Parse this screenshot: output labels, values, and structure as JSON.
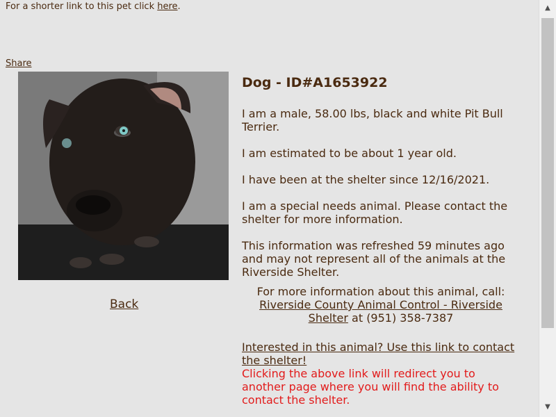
{
  "header": {
    "shortlink_text": "For a shorter link to this pet click ",
    "shortlink_link": "here",
    "shortlink_end": "."
  },
  "share_label": "Share",
  "pet": {
    "title": "Dog - ID#A1653922",
    "description": "I am a male, 58.00 lbs, black and white Pit Bull Terrier.",
    "age": "I am estimated to be about 1 year old.",
    "since": "I have been at the shelter since 12/16/2021.",
    "special_needs": "I am a special needs animal. Please contact the shelter for more information.",
    "refresh": "This information was refreshed 59 minutes ago and may not represent all of the animals at the Riverside Shelter."
  },
  "contact": {
    "intro": "For more information about this animal, call:",
    "shelter_link": "Riverside County Animal Control - Riverside Shelter",
    "phone": " at (951) 358-7387"
  },
  "interest_link": "Interested in this animal? Use this link to contact the shelter!",
  "redirect_notice": "Clicking the above link will redirect you to another page where you will find the ability to contact the shelter.",
  "back_label": "Back",
  "colors": {
    "text": "#4a2a10",
    "warning": "#e21b1b",
    "background": "#e5e5e5"
  },
  "icons": {
    "scroll_up": "triangle-up-icon",
    "scroll_down": "triangle-down-icon"
  }
}
